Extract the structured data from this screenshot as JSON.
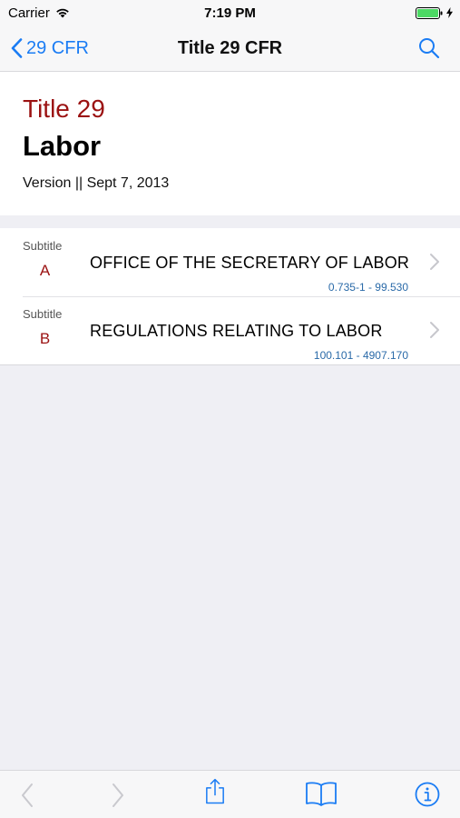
{
  "status_bar": {
    "carrier": "Carrier",
    "time": "7:19 PM",
    "battery_color": "#4cd964"
  },
  "nav": {
    "back_label": "29 CFR",
    "title": "Title 29 CFR",
    "accent_color": "#1a7cf4",
    "search_icon": "search-icon"
  },
  "header": {
    "title_number": "Title 29",
    "title_name": "Labor",
    "version": "Version || Sept 7, 2013"
  },
  "subtitles": [
    {
      "label": "Subtitle",
      "letter": "A",
      "name": "OFFICE OF THE SECRETARY OF LABOR",
      "range": "0.735-1 - 99.530"
    },
    {
      "label": "Subtitle",
      "letter": "B",
      "name": "REGULATIONS RELATING TO LABOR",
      "range": "100.101 - 4907.170"
    }
  ],
  "toolbar": {
    "items": [
      "back-arrow-icon",
      "forward-arrow-icon",
      "share-icon",
      "book-icon",
      "info-icon"
    ]
  },
  "colors": {
    "title_red": "#9b1212",
    "range_blue": "#2a6aa8"
  }
}
